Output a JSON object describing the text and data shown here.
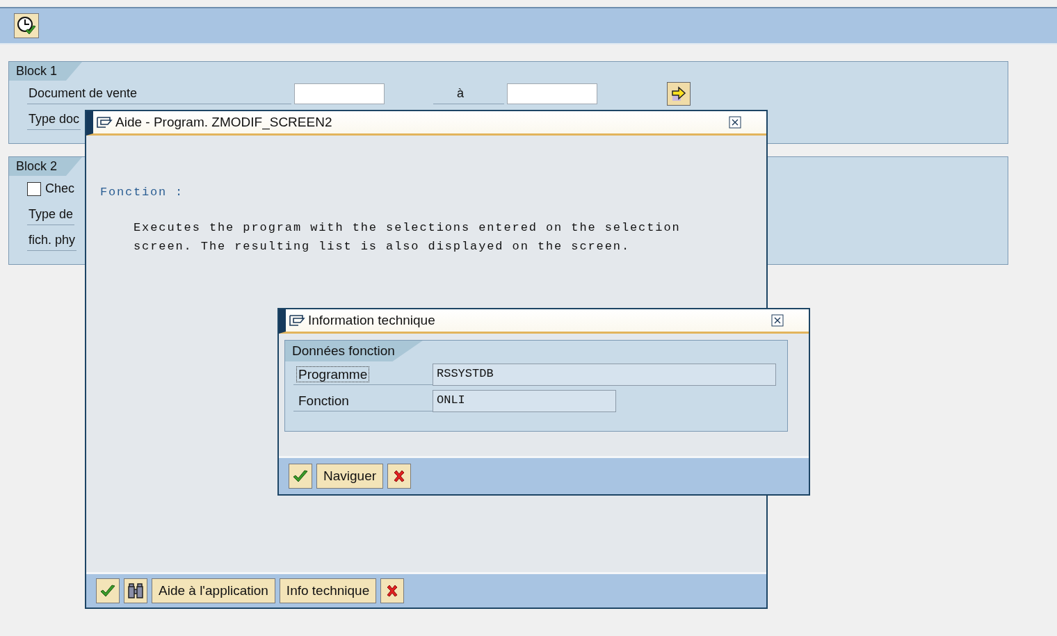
{
  "blocks": [
    {
      "title": "Block 1",
      "rows": [
        {
          "kind": "range",
          "label": "Document de vente",
          "separator": "à"
        },
        {
          "kind": "field",
          "label": "Type doc"
        }
      ]
    },
    {
      "title": "Block 2",
      "rows": [
        {
          "kind": "checkbox",
          "label": "Chec",
          "checked": false
        },
        {
          "kind": "field",
          "label": "Type de"
        },
        {
          "kind": "field",
          "label": "fich. phy"
        }
      ]
    }
  ],
  "help_dialog": {
    "title": "Aide - Program. ZMODIF_SCREEN2",
    "heading": "Fonction :",
    "text": "Executes the program with the selections entered on the selection\nscreen. The resulting list is also displayed on the screen.",
    "buttons": [
      {
        "kind": "confirm"
      },
      {
        "kind": "find"
      },
      {
        "kind": "text",
        "label": "Aide à l'application"
      },
      {
        "kind": "text",
        "label": "Info technique"
      },
      {
        "kind": "cancel"
      }
    ]
  },
  "info_dialog": {
    "title": "Information technique",
    "group_title": "Données fonction",
    "fields": [
      {
        "label": "Programme",
        "value": "RSSYSTDB",
        "focused": true,
        "wide": true
      },
      {
        "label": "Fonction",
        "value": "ONLI",
        "focused": false,
        "wide": false
      }
    ],
    "buttons": [
      {
        "kind": "confirm"
      },
      {
        "kind": "text",
        "label": "Naviguer"
      },
      {
        "kind": "cancel"
      }
    ]
  }
}
